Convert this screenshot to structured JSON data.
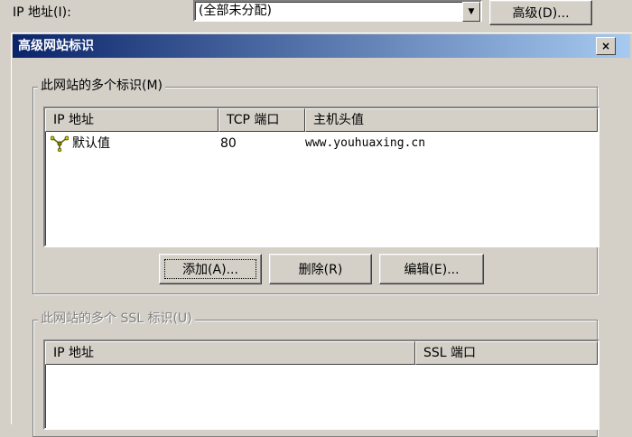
{
  "parent": {
    "ip_label": "IP 地址(I):",
    "ip_value": "(全部未分配)",
    "advanced_button": "高级(D)..."
  },
  "dialog": {
    "title": "高级网站标识",
    "close_glyph": "×"
  },
  "identities": {
    "legend": "此网站的多个标识(M)",
    "columns": [
      "IP 地址",
      "TCP 端口",
      "主机头值"
    ],
    "rows": [
      {
        "ip": "默认值",
        "port": "80",
        "host": "www.youhuaxing.cn"
      }
    ],
    "buttons": {
      "add": "添加(A)...",
      "remove": "删除(R)",
      "edit": "编辑(E)..."
    }
  },
  "ssl": {
    "legend": "此网站的多个 SSL 标识(U)",
    "columns": [
      "IP 地址",
      "SSL 端口"
    ]
  }
}
